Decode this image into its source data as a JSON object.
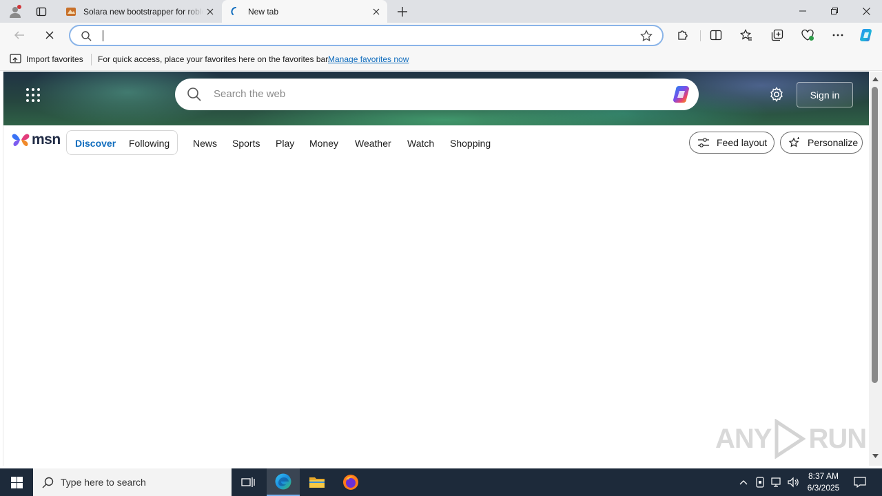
{
  "browser": {
    "tabs": [
      {
        "title": "Solara new bootstrapper for roblox",
        "active": false
      },
      {
        "title": "New tab",
        "active": true
      }
    ],
    "address_bar": {
      "value": "",
      "placeholder": ""
    }
  },
  "favorites_bar": {
    "import_label": "Import favorites",
    "message": "For quick access, place your favorites here on the favorites bar.",
    "link": "Manage favorites now"
  },
  "msn": {
    "logo_text": "msn",
    "search_placeholder": "Search the web",
    "sign_in": "Sign in",
    "feed_tabs": [
      "Discover",
      "Following"
    ],
    "nav": [
      "News",
      "Sports",
      "Play",
      "Money",
      "Weather",
      "Watch",
      "Shopping"
    ],
    "feed_layout": "Feed layout",
    "personalize": "Personalize"
  },
  "watermark": {
    "left": "ANY",
    "right": "RUN"
  },
  "taskbar": {
    "search_placeholder": "Type here to search",
    "time": "8:37 AM",
    "date": "6/3/2025"
  },
  "colors": {
    "accent": "#0f6cbd",
    "taskbar": "#1d2a3a",
    "address_border": "#8ab4e8"
  }
}
